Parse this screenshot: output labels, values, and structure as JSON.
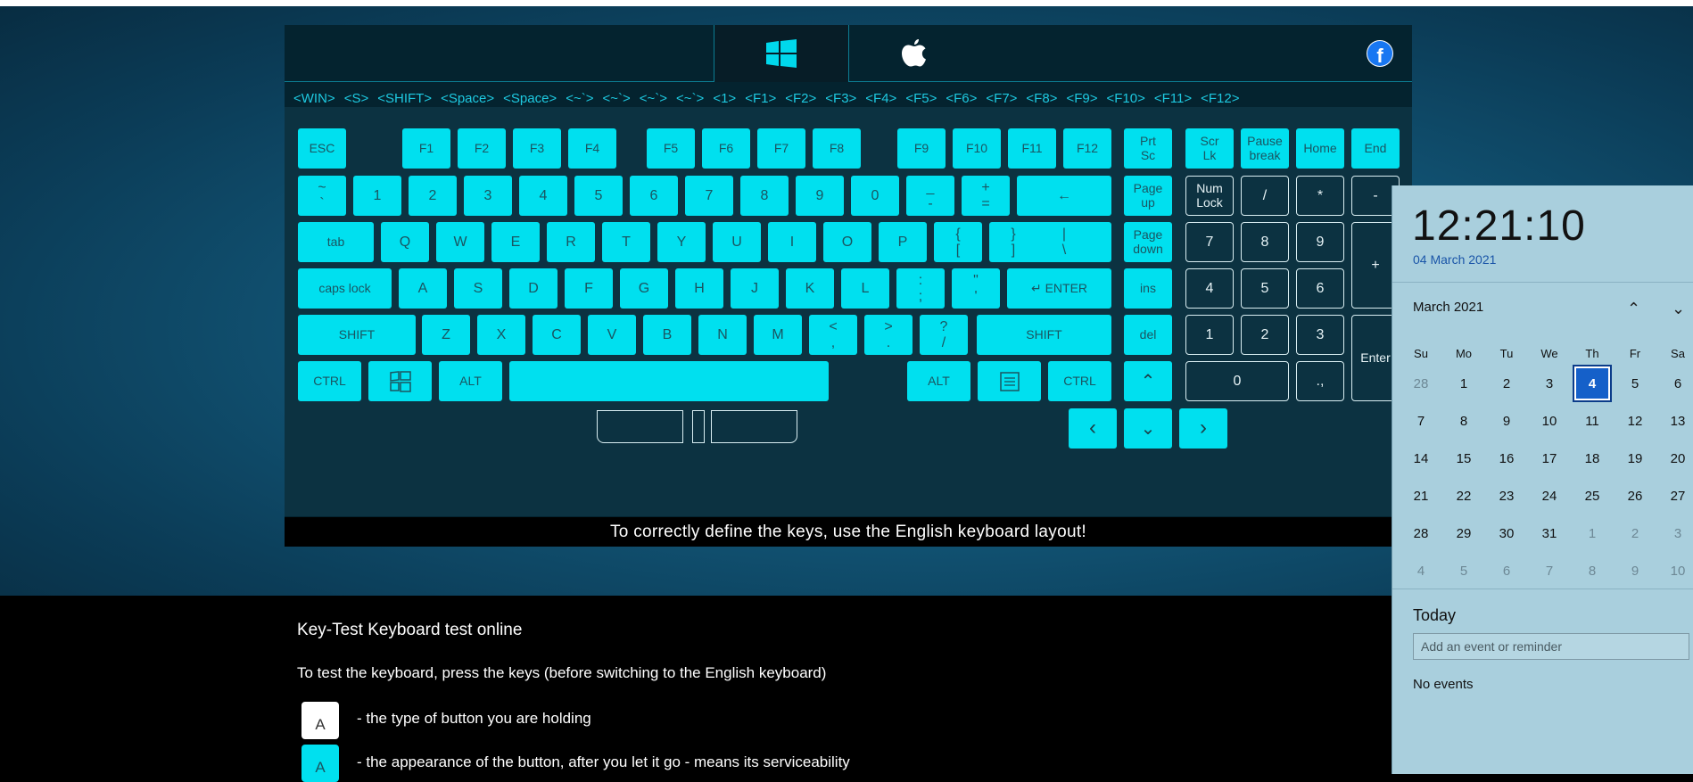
{
  "header": {
    "history": [
      "<WIN>",
      "<S>",
      "<SHIFT>",
      "<Space>",
      "<Space>",
      "<~`>",
      "<~`>",
      "<~`>",
      "<~`>",
      "<1>",
      "<F1>",
      "<F2>",
      "<F3>",
      "<F4>",
      "<F5>",
      "<F6>",
      "<F7>",
      "<F8>",
      "<F9>",
      "<F10>",
      "<F11>",
      "<F12>"
    ]
  },
  "keyboard": {
    "row0": [
      "ESC",
      "F1",
      "F2",
      "F3",
      "F4",
      "F5",
      "F6",
      "F7",
      "F8",
      "F9",
      "F10",
      "F11",
      "F12",
      "Prt\nSc",
      "Scr\nLk",
      "Pause\nbreak",
      "Home",
      "End"
    ],
    "row1": [
      "~\n`",
      "1",
      "2",
      "3",
      "4",
      "5",
      "6",
      "7",
      "8",
      "9",
      "0",
      "_\n-",
      "+\n=",
      "←",
      "Page\nup",
      "Num\nLock",
      "/",
      "*",
      "-"
    ],
    "row2": [
      "tab",
      "Q",
      "W",
      "E",
      "R",
      "T",
      "Y",
      "U",
      "I",
      "O",
      "P",
      "{\n[",
      "}\n]",
      "|\n\\",
      "Page\ndown",
      "7",
      "8",
      "9",
      "+"
    ],
    "row3": [
      "caps lock",
      "A",
      "S",
      "D",
      "F",
      "G",
      "H",
      "J",
      "K",
      "L",
      ":\n;",
      "\"\n'",
      "↵ ENTER",
      "ins",
      "4",
      "5",
      "6"
    ],
    "row4": [
      "SHIFT",
      "Z",
      "X",
      "C",
      "V",
      "B",
      "N",
      "M",
      "<\n,",
      ">\n.",
      "?\n/",
      "SHIFT",
      "del",
      "1",
      "2",
      "3",
      "Enter"
    ],
    "row5": [
      "CTRL",
      "ALT",
      "ALT",
      "CTRL",
      "0",
      ".,"
    ],
    "footer": "To correctly define the keys, use the English keyboard layout!"
  },
  "content": {
    "title": "Key-Test Keyboard test online",
    "lead": "To test the keyboard, press the keys (before switching to the English keyboard)",
    "legend_key": "A",
    "legend1": "- the type of button you are holding",
    "legend2": "- the appearance of the button, after you let it go - means its serviceability"
  },
  "clock": {
    "time": "12:21:10",
    "date": "04 March 2021",
    "month": "March 2021",
    "weekdays": [
      "Su",
      "Mo",
      "Tu",
      "We",
      "Th",
      "Fr",
      "Sa"
    ],
    "days": [
      [
        "28",
        "1",
        "2",
        "3",
        "4",
        "5",
        "6"
      ],
      [
        "7",
        "8",
        "9",
        "10",
        "11",
        "12",
        "13"
      ],
      [
        "14",
        "15",
        "16",
        "17",
        "18",
        "19",
        "20"
      ],
      [
        "21",
        "22",
        "23",
        "24",
        "25",
        "26",
        "27"
      ],
      [
        "28",
        "29",
        "30",
        "31",
        "1",
        "2",
        "3"
      ],
      [
        "4",
        "5",
        "6",
        "7",
        "8",
        "9",
        "10"
      ]
    ],
    "today_label": "Today",
    "add_event_placeholder": "Add an event or reminder",
    "no_events": "No events"
  }
}
